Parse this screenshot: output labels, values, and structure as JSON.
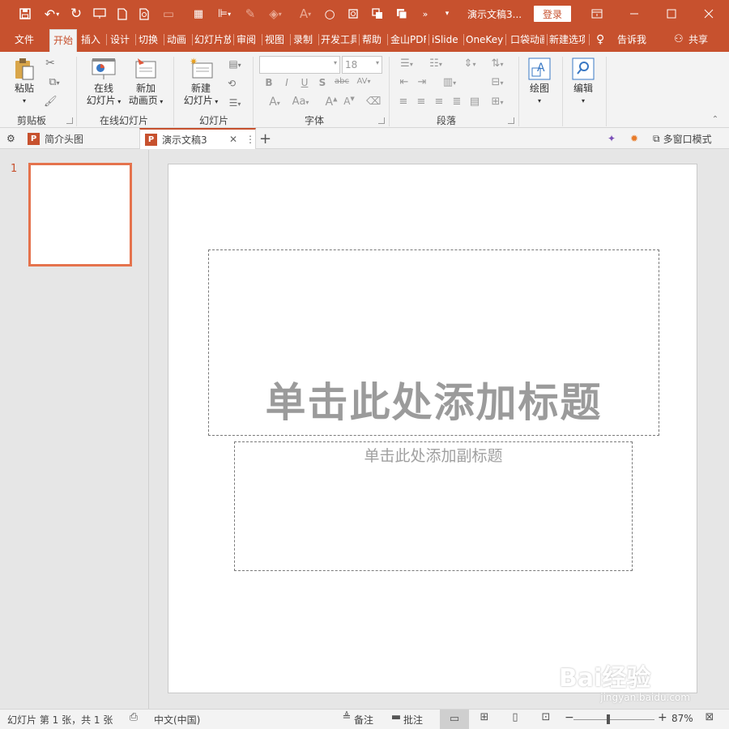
{
  "titlebar": {
    "document_title": "演示文稿3...",
    "login_label": "登录",
    "accent_color": "#c7512e"
  },
  "tabs": [
    {
      "label": "文件"
    },
    {
      "label": "开始"
    },
    {
      "label": "插入"
    },
    {
      "label": "设计"
    },
    {
      "label": "切换"
    },
    {
      "label": "动画"
    },
    {
      "label": "幻灯片放映"
    },
    {
      "label": "审阅"
    },
    {
      "label": "视图"
    },
    {
      "label": "录制"
    },
    {
      "label": "开发工具"
    },
    {
      "label": "帮助"
    },
    {
      "label": "金山PDF"
    },
    {
      "label": "iSlide"
    },
    {
      "label": "OneKey"
    },
    {
      "label": "口袋动画"
    },
    {
      "label": "新建选项卡"
    }
  ],
  "tell_me_label": "告诉我",
  "share_label": "共享",
  "ribbon": {
    "clipboard": {
      "paste_label": "粘贴",
      "group_label": "剪贴板"
    },
    "online_slides": {
      "online_label_1": "在线",
      "online_label_2": "幻灯片",
      "add_anim_label_1": "新加",
      "add_anim_label_2": "动画页",
      "group_label": "在线幻灯片"
    },
    "slides": {
      "new_slide_label_1": "新建",
      "new_slide_label_2": "幻灯片",
      "group_label": "幻灯片"
    },
    "font": {
      "font_name": "",
      "font_size": "18",
      "group_label": "字体"
    },
    "paragraph": {
      "group_label": "段落"
    },
    "drawing": {
      "label": "绘图"
    },
    "editing": {
      "label": "编辑"
    }
  },
  "doc_tabs": [
    {
      "label": "简介头图"
    },
    {
      "label": "演示文稿3"
    }
  ],
  "multi_window_label": "多窗口模式",
  "thumbnails": [
    {
      "number": "1"
    }
  ],
  "slide": {
    "title_placeholder": "单击此处添加标题",
    "subtitle_placeholder": "单击此处添加副标题"
  },
  "status_bar": {
    "slide_info": "幻灯片 第 1 张，共 1 张",
    "language": "中文(中国)",
    "notes_label": "备注",
    "comments_label": "批注",
    "zoom": "87%",
    "zoom_level": 0.87
  },
  "watermark": {
    "text": "Bai经验",
    "url": "jingyan.baidu.com"
  }
}
